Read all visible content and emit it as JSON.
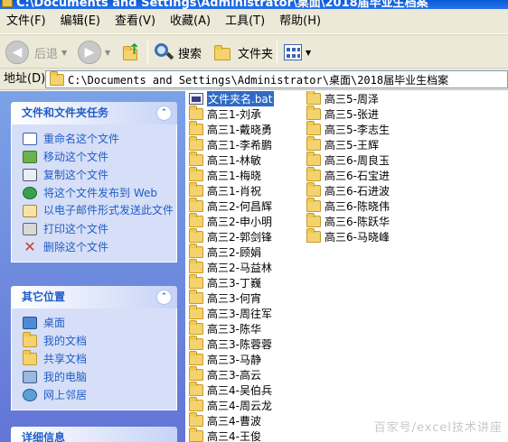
{
  "window": {
    "title": "C:\\Documents and Settings\\Administrator\\桌面\\2018届毕业生档案"
  },
  "menu": [
    "文件(F)",
    "编辑(E)",
    "查看(V)",
    "收藏(A)",
    "工具(T)",
    "帮助(H)"
  ],
  "toolbar": {
    "back_label": "后退",
    "search_label": "搜索",
    "folders_label": "文件夹"
  },
  "address": {
    "label": "地址(D)",
    "path": "C:\\Documents and Settings\\Administrator\\桌面\\2018届毕业生档案"
  },
  "file_tasks": {
    "title": "文件和文件夹任务",
    "items": [
      "重命名这个文件",
      "移动这个文件",
      "复制这个文件",
      "将这个文件发布到 Web",
      "以电子邮件形式发送此文件",
      "打印这个文件",
      "删除这个文件"
    ]
  },
  "other_places": {
    "title": "其它位置",
    "items": [
      "桌面",
      "我的文档",
      "共享文档",
      "我的电脑",
      "网上邻居"
    ]
  },
  "details": {
    "title": "详细信息"
  },
  "files": {
    "col1": [
      "文件夹名.bat",
      "高三1-刘承",
      "高三1-戴晓勇",
      "高三1-李希鹏",
      "高三1-林敏",
      "高三1-梅晓",
      "高三1-肖祝",
      "高三2-何昌辉",
      "高三2-申小明",
      "高三2-郭剑锋",
      "高三2-顾娟",
      "高三2-马益林",
      "高三3-丁巍",
      "高三3-何宵",
      "高三3-周往军",
      "高三3-陈华",
      "高三3-陈蓉蓉",
      "高三3-马静",
      "高三3-高云",
      "高三4-吴伯兵",
      "高三4-周云龙",
      "高三4-曹波",
      "高三4-王俊"
    ],
    "col2": [
      "高三5-周泽",
      "高三5-张进",
      "高三5-李志生",
      "高三5-王辉",
      "高三6-周良玉",
      "高三6-石宝进",
      "高三6-石进波",
      "高三6-陈晓伟",
      "高三6-陈跃华",
      "高三6-马晓峰"
    ]
  },
  "watermark": "百家号/excel技术讲座",
  "colors": {
    "title_bar": "#0a5bd8",
    "task_pane": "#7ba2e7",
    "task_link": "#215dc6",
    "selection": "#316ac5"
  }
}
